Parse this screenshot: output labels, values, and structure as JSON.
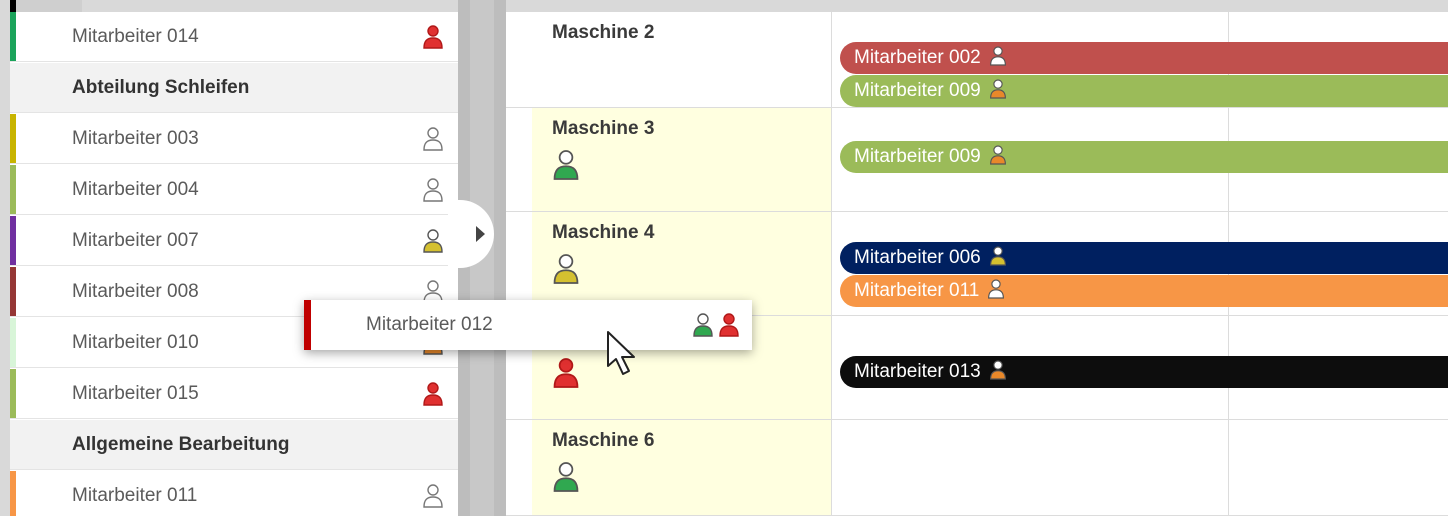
{
  "left_panel": {
    "rows": [
      {
        "type": "employee",
        "label": "Mitarbeiter 014",
        "stripe": "#1aa35a",
        "icon": "person-red-icon"
      },
      {
        "type": "group",
        "label": "Abteilung Schleifen"
      },
      {
        "type": "employee",
        "label": "Mitarbeiter 003",
        "stripe": "#c8b400",
        "icon": "person-outline-icon"
      },
      {
        "type": "employee",
        "label": "Mitarbeiter 004",
        "stripe": "#9bbb59",
        "icon": "person-outline-icon"
      },
      {
        "type": "employee",
        "label": "Mitarbeiter 007",
        "stripe": "#7030a0",
        "icon": "person-yellow-icon"
      },
      {
        "type": "employee",
        "label": "Mitarbeiter 008",
        "stripe": "#953735",
        "icon": "person-outline-icon"
      },
      {
        "type": "employee",
        "label": "Mitarbeiter 010",
        "stripe": "#d8f5d8",
        "icon": "person-orange-icon"
      },
      {
        "type": "employee",
        "label": "Mitarbeiter 015",
        "stripe": "#9bbb59",
        "icon": "person-red-icon"
      },
      {
        "type": "group",
        "label": "Allgemeine Bearbeitung"
      },
      {
        "type": "employee",
        "label": "Mitarbeiter 011",
        "stripe": "#f79646",
        "icon": "person-outline-icon"
      }
    ]
  },
  "machines": [
    {
      "name": "Maschine 2",
      "icon": "",
      "bars": [
        {
          "label": "Mitarbeiter 002",
          "color": "#c0504d",
          "icon": "person-white-icon"
        },
        {
          "label": "Mitarbeiter 009",
          "color": "#9bbb59",
          "icon": "person-orange-icon"
        }
      ]
    },
    {
      "name": "Maschine 3",
      "icon": "person-green-icon",
      "bars": [
        {
          "label": "Mitarbeiter 009",
          "color": "#9bbb59",
          "icon": "person-orange-icon"
        }
      ]
    },
    {
      "name": "Maschine 4",
      "icon": "person-yellow-icon",
      "bars": [
        {
          "label": "Mitarbeiter 006",
          "color": "#002060",
          "icon": "person-yellow-icon"
        },
        {
          "label": "Mitarbeiter 011",
          "color": "#f79646",
          "icon": "person-white-icon"
        }
      ]
    },
    {
      "name": "",
      "icon": "person-red-icon",
      "bars": [
        {
          "label": "Mitarbeiter 013",
          "color": "#0d0d0d",
          "icon": "person-orange-icon"
        }
      ]
    },
    {
      "name": "Maschine 6",
      "icon": "person-green-icon",
      "bars": []
    }
  ],
  "drag_ghost": {
    "label": "Mitarbeiter 012",
    "icons": [
      "person-green-icon",
      "person-red-icon"
    ]
  }
}
